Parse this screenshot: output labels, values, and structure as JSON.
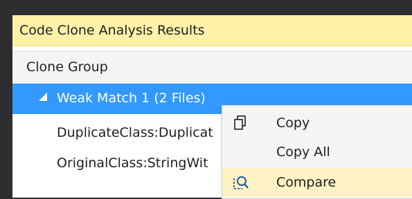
{
  "panel": {
    "title": "Code Clone Analysis Results",
    "column_header": "Clone Group"
  },
  "tree": {
    "group": {
      "label": "Weak Match 1 (2 Files)",
      "expanded": true,
      "selected": true
    },
    "children": [
      {
        "label": "DuplicateClass:Duplicat"
      },
      {
        "label": "OriginalClass:StringWit"
      }
    ]
  },
  "context_menu": {
    "items": [
      {
        "label": "Copy",
        "icon": "copy-icon",
        "highlighted": false
      },
      {
        "label": "Copy All",
        "icon": "",
        "highlighted": false
      },
      {
        "label": "Compare",
        "icon": "compare-icon",
        "highlighted": true
      }
    ]
  },
  "colors": {
    "title_bar_bg": "#fff2a8",
    "selection_bg": "#3399ff",
    "menu_highlight_bg": "#fff2c3",
    "icon_blue": "#1e5ba8"
  }
}
